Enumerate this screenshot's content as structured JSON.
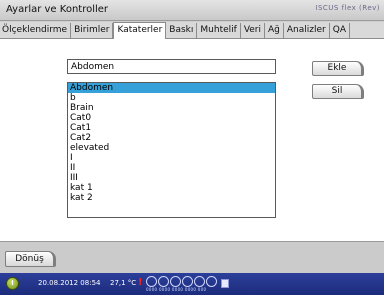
{
  "window": {
    "title": "Ayarlar ve Kontroller",
    "brand": "ISCUS flex (Rev)"
  },
  "tabs": [
    {
      "label": "Ölçeklendirme",
      "active": false
    },
    {
      "label": "Birimler",
      "active": false
    },
    {
      "label": "Kataterler",
      "active": true
    },
    {
      "label": "Baskı",
      "active": false
    },
    {
      "label": "Muhtelif",
      "active": false
    },
    {
      "label": "Veri",
      "active": false
    },
    {
      "label": "Ağ",
      "active": false
    },
    {
      "label": "Analizler",
      "active": false
    },
    {
      "label": "QA",
      "active": false
    }
  ],
  "form": {
    "name_value": "Abdomen",
    "add_label": "Ekle",
    "delete_label": "Sil"
  },
  "list": {
    "selected_index": 0,
    "items": [
      "Abdomen",
      "b",
      "Brain",
      "Cat0",
      "Cat1",
      "Cat2",
      "elevated",
      "I",
      "II",
      "III",
      "kat 1",
      "kat 2"
    ]
  },
  "footer": {
    "back_label": "Dönüş"
  },
  "status": {
    "datetime": "20.08.2012 08:54",
    "temperature": "27,1 °C",
    "alert": "!",
    "sensor_digits": "0000 0000 0000 0000 000",
    "colors": {
      "bar": "#1c2c7c",
      "alert": "#ff2020",
      "selection": "#36a1d8"
    }
  }
}
